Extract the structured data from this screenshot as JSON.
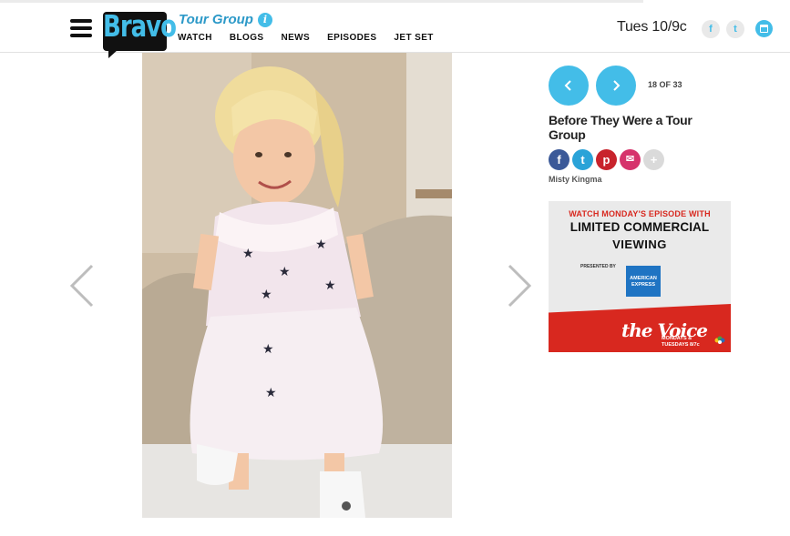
{
  "header": {
    "logo_text": "Bravo",
    "show_title": "Tour Group",
    "nav": [
      "WATCH",
      "BLOGS",
      "NEWS",
      "EPISODES",
      "JET SET"
    ],
    "airtime": "Tues 10/9c",
    "social": [
      "f",
      "t"
    ],
    "brand_color": "#43bde8"
  },
  "gallery": {
    "counter": "18 OF 33",
    "title": "Before They Were a Tour Group",
    "share_icons": [
      "facebook-icon",
      "twitter-icon",
      "pinterest-icon",
      "email-icon",
      "plus-icon"
    ],
    "share_glyphs": [
      "f",
      "t",
      "p",
      "✉",
      "+"
    ],
    "credit": "Misty Kingma"
  },
  "ad": {
    "line1": "WATCH MONDAY'S EPISODE WITH",
    "line2": "LIMITED COMMERCIAL",
    "line3": "VIEWING",
    "presented_by": "PRESENTED BY",
    "amex_line1": "AMERICAN",
    "amex_line2": "EXPRESS",
    "show": "the Voice",
    "times_line1": "MONDAYS &",
    "times_line2": "TUESDAYS 8/7c",
    "network": "NBC"
  }
}
